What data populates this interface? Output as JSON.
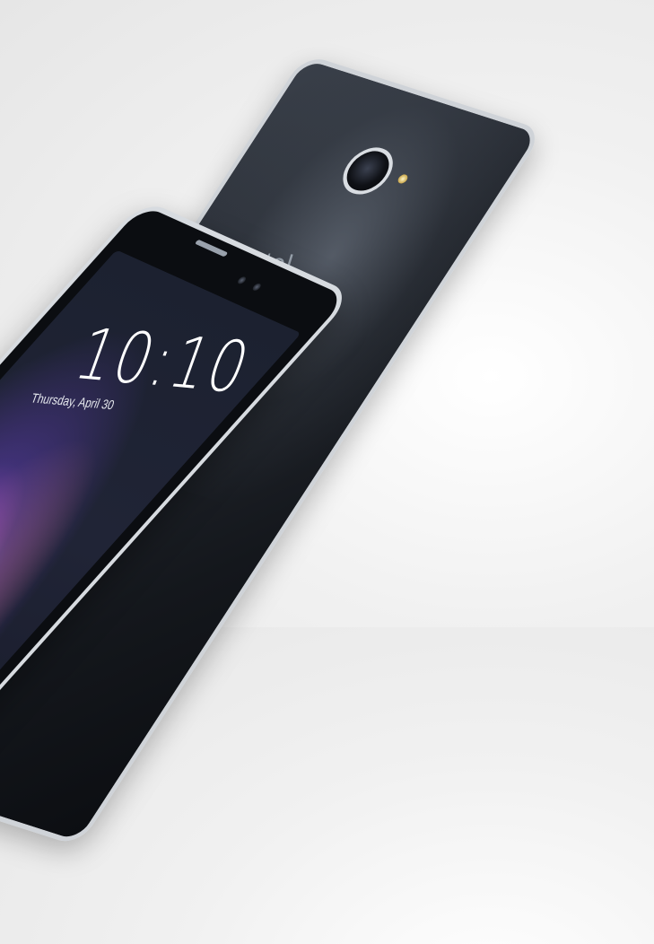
{
  "photo": {
    "lock_time": "10:10",
    "lock_date": "Thursday, April 30",
    "brand_text": "atel"
  },
  "colors": {
    "background": "#ececec",
    "phone_body": "#1b1f26",
    "frame_metal": "#d7dbe0",
    "screen_glow": "#ff96f0"
  }
}
